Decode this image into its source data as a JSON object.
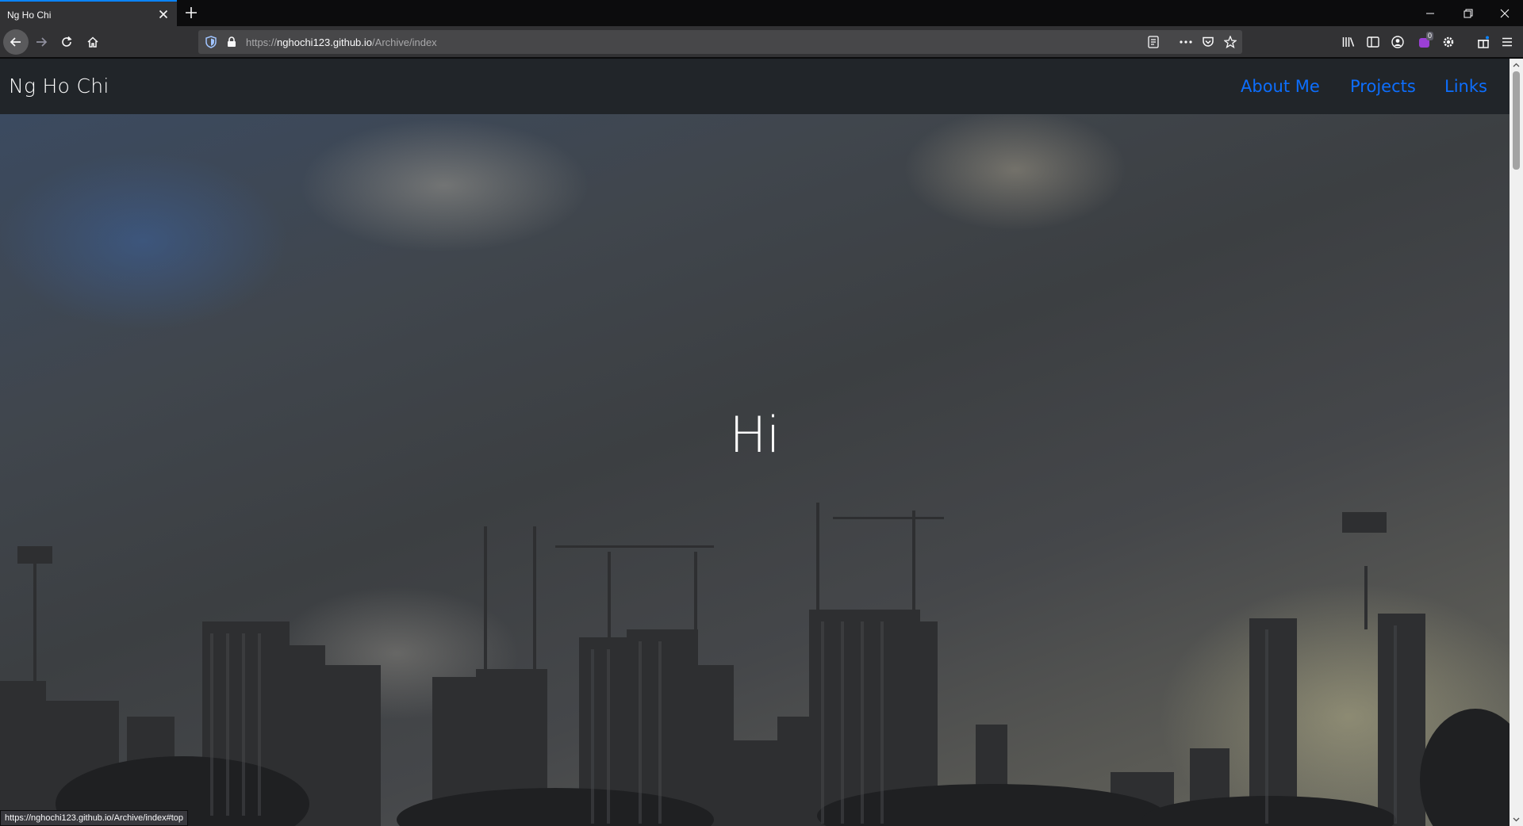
{
  "browser": {
    "tab_title": "Ng Ho Chi",
    "url_prefix": "https://",
    "url_host": "nghochi123.github.io",
    "url_path": "/Archive/index",
    "extension_badge": "0",
    "status_url": "https://nghochi123.github.io/Archive/index#top",
    "accent": "#0a84ff"
  },
  "site": {
    "brand": "Ng Ho Chi",
    "nav": [
      {
        "label": "About Me"
      },
      {
        "label": "Projects"
      },
      {
        "label": "Links"
      }
    ],
    "hero_heading": "Hi",
    "link_color": "#0d6efd",
    "navbar_color": "#212529"
  },
  "icons": [
    "close-icon",
    "plus-icon",
    "minimize-icon",
    "restore-icon",
    "back-arrow-icon",
    "forward-arrow-icon",
    "reload-icon",
    "home-icon",
    "shield-icon",
    "lock-icon",
    "reader-view-icon",
    "more-icon",
    "pocket-icon",
    "star-icon",
    "library-icon",
    "sidebar-icon",
    "account-icon",
    "extension-icon",
    "gear-extension-icon",
    "gift-icon",
    "menu-icon"
  ]
}
